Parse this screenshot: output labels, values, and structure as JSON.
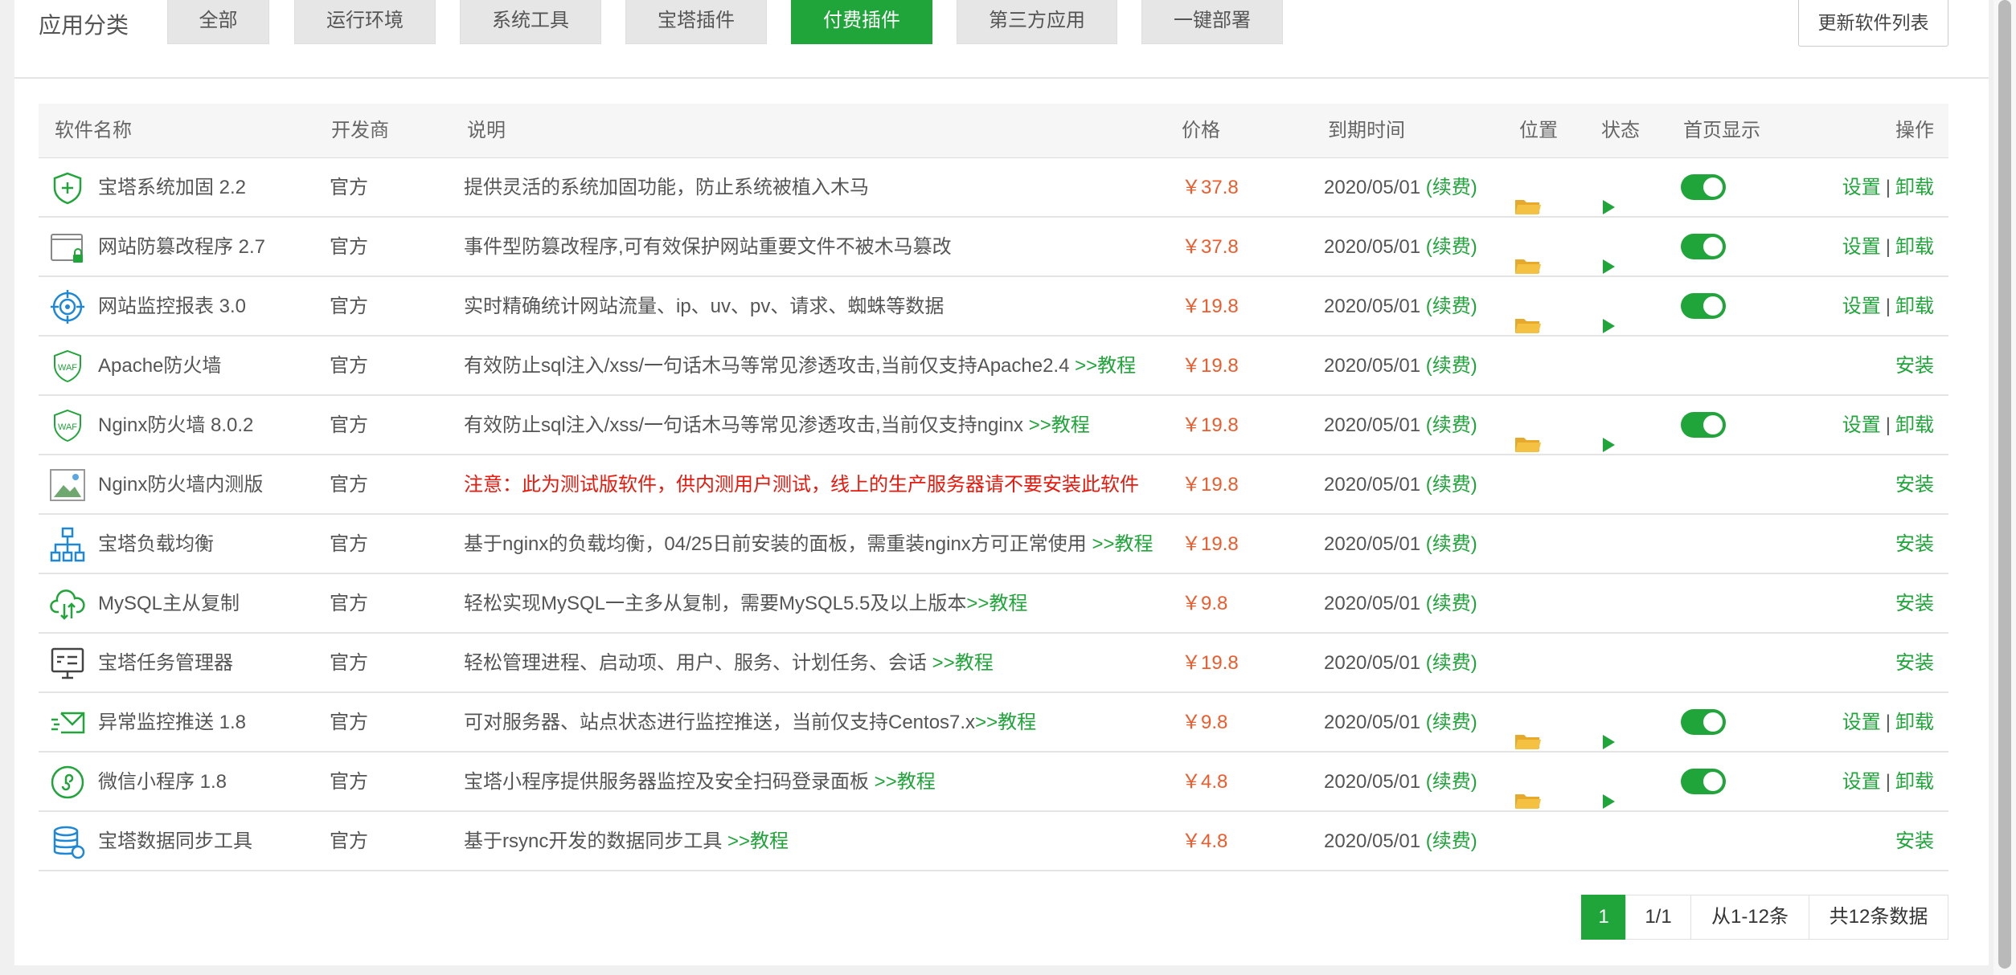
{
  "categories": {
    "label": "应用分类",
    "items": [
      "全部",
      "运行环境",
      "系统工具",
      "宝塔插件",
      "付费插件",
      "第三方应用",
      "一键部署"
    ],
    "active": "付费插件"
  },
  "refresh_button": "更新软件列表",
  "table": {
    "headers": [
      "软件名称",
      "开发商",
      "说明",
      "价格",
      "到期时间",
      "位置",
      "状态",
      "首页显示",
      "操作"
    ],
    "rows": [
      {
        "icon": "shield-plus-icon",
        "name": "宝塔系统加固 2.2",
        "dev": "官方",
        "desc": "提供灵活的系统加固功能，防止系统被植入木马",
        "link": "",
        "price": "￥37.8",
        "expire": "2020/05/01",
        "renew": "(续费)",
        "installed": true,
        "ops": [
          "设置",
          "卸载"
        ]
      },
      {
        "icon": "browser-lock-icon",
        "name": "网站防篡改程序 2.7",
        "dev": "官方",
        "desc": "事件型防篡改程序,可有效保护网站重要文件不被木马篡改",
        "link": "",
        "price": "￥37.8",
        "expire": "2020/05/01",
        "renew": "(续费)",
        "installed": true,
        "ops": [
          "设置",
          "卸载"
        ]
      },
      {
        "icon": "target-icon",
        "name": "网站监控报表 3.0",
        "dev": "官方",
        "desc": "实时精确统计网站流量、ip、uv、pv、请求、蜘蛛等数据",
        "link": "",
        "price": "￥19.8",
        "expire": "2020/05/01",
        "renew": "(续费)",
        "installed": true,
        "ops": [
          "设置",
          "卸载"
        ]
      },
      {
        "icon": "waf-shield-icon",
        "name": "Apache防火墙",
        "dev": "官方",
        "desc": "有效防止sql注入/xss/一句话木马等常见渗透攻击,当前仅支持Apache2.4 ",
        "link": ">>教程",
        "price": "￥19.8",
        "expire": "2020/05/01",
        "renew": "(续费)",
        "installed": false,
        "ops": [
          "安装"
        ]
      },
      {
        "icon": "waf-shield-icon",
        "name": "Nginx防火墙 8.0.2",
        "dev": "官方",
        "desc": "有效防止sql注入/xss/一句话木马等常见渗透攻击,当前仅支持nginx ",
        "link": ">>教程",
        "price": "￥19.8",
        "expire": "2020/05/01",
        "renew": "(续费)",
        "installed": true,
        "ops": [
          "设置",
          "卸载"
        ]
      },
      {
        "icon": "broken-image-icon",
        "name": "Nginx防火墙内测版",
        "dev": "官方",
        "desc": "注意：此为测试版软件，供内测用户测试，线上的生产服务器请不要安装此软件",
        "link": "",
        "warn": true,
        "price": "￥19.8",
        "expire": "2020/05/01",
        "renew": "(续费)",
        "installed": false,
        "ops": [
          "安装"
        ]
      },
      {
        "icon": "network-tree-icon",
        "name": "宝塔负载均衡",
        "dev": "官方",
        "desc": "基于nginx的负载均衡，04/25日前安装的面板，需重装nginx方可正常使用 ",
        "link": ">>教程",
        "price": "￥19.8",
        "expire": "2020/05/01",
        "renew": "(续费)",
        "installed": false,
        "ops": [
          "安装"
        ]
      },
      {
        "icon": "cloud-sync-icon",
        "name": "MySQL主从复制",
        "dev": "官方",
        "desc": "轻松实现MySQL一主多从复制，需要MySQL5.5及以上版本",
        "link": ">>教程",
        "price": "￥9.8",
        "expire": "2020/05/01",
        "renew": "(续费)",
        "installed": false,
        "ops": [
          "安装"
        ]
      },
      {
        "icon": "monitor-icon",
        "name": "宝塔任务管理器",
        "dev": "官方",
        "desc": "轻松管理进程、启动项、用户、服务、计划任务、会话 ",
        "link": ">>教程",
        "price": "￥19.8",
        "expire": "2020/05/01",
        "renew": "(续费)",
        "installed": false,
        "ops": [
          "安装"
        ]
      },
      {
        "icon": "send-mail-icon",
        "name": "异常监控推送 1.8",
        "dev": "官方",
        "desc": "可对服务器、站点状态进行监控推送，当前仅支持Centos7.x",
        "link": ">>教程",
        "price": "￥9.8",
        "expire": "2020/05/01",
        "renew": "(续费)",
        "installed": true,
        "ops": [
          "设置",
          "卸载"
        ]
      },
      {
        "icon": "miniprogram-icon",
        "name": "微信小程序 1.8",
        "dev": "官方",
        "desc": "宝塔小程序提供服务器监控及安全扫码登录面板 ",
        "link": ">>教程",
        "price": "￥4.8",
        "expire": "2020/05/01",
        "renew": "(续费)",
        "installed": true,
        "ops": [
          "设置",
          "卸载"
        ]
      },
      {
        "icon": "database-sync-icon",
        "name": "宝塔数据同步工具",
        "dev": "官方",
        "desc": "基于rsync开发的数据同步工具 ",
        "link": ">>教程",
        "price": "￥4.8",
        "expire": "2020/05/01",
        "renew": "(续费)",
        "installed": false,
        "ops": [
          "安装"
        ]
      }
    ]
  },
  "pagination": {
    "current": "1",
    "pages": "1/1",
    "range": "从1-12条",
    "total": "共12条数据"
  },
  "colors": {
    "accent": "#20a53a",
    "price": "#ef5b2a",
    "warning": "#e8180c",
    "folder": "#f5c142"
  }
}
